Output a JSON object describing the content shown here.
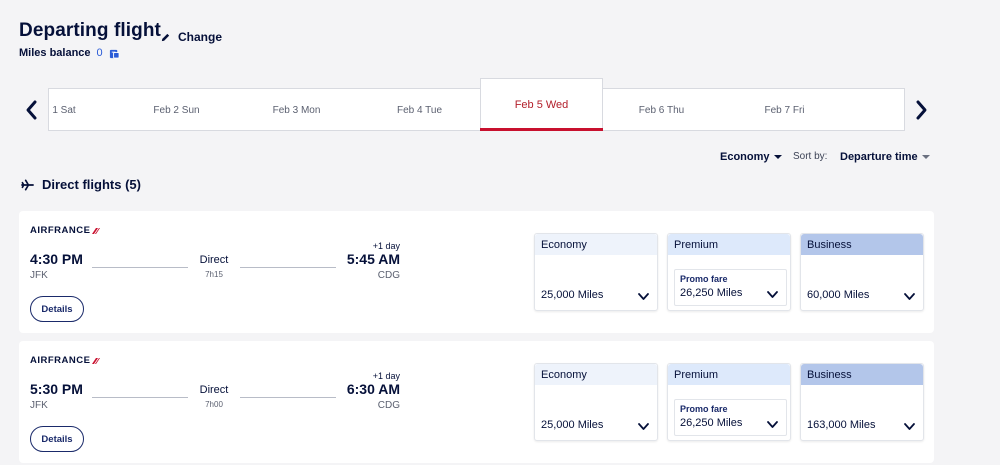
{
  "header": {
    "title": "Departing flight",
    "miles_label": "Miles balance",
    "miles_value": "0",
    "change_label": "Change"
  },
  "dates": [
    {
      "label": "1 Sat",
      "active": false
    },
    {
      "label": "Feb 2 Sun",
      "active": false
    },
    {
      "label": "Feb 3 Mon",
      "active": false
    },
    {
      "label": "Feb 4 Tue",
      "active": false
    },
    {
      "label": "Feb 5 Wed",
      "active": true
    },
    {
      "label": "Feb 6 Thu",
      "active": false
    },
    {
      "label": "Feb 7 Fri",
      "active": false
    }
  ],
  "filters": {
    "cabin": "Economy",
    "sort_label": "Sort by:",
    "sort_value": "Departure time"
  },
  "section_title": "Direct flights (5)",
  "flights": [
    {
      "airline": "AIRFRANCE",
      "dep_time": "4:30 PM",
      "dep_code": "JFK",
      "stops": "Direct",
      "duration": "7h15",
      "plus_day": "+1 day",
      "arr_time": "5:45 AM",
      "arr_code": "CDG",
      "details_label": "Details",
      "fares": {
        "economy": {
          "label": "Economy",
          "miles": "25,000 Miles"
        },
        "premium": {
          "label": "Premium",
          "promo": "Promo fare",
          "miles": "26,250 Miles"
        },
        "business": {
          "label": "Business",
          "miles": "60,000 Miles"
        }
      }
    },
    {
      "airline": "AIRFRANCE",
      "dep_time": "5:30 PM",
      "dep_code": "JFK",
      "stops": "Direct",
      "duration": "7h00",
      "plus_day": "+1 day",
      "arr_time": "6:30 AM",
      "arr_code": "CDG",
      "details_label": "Details",
      "fares": {
        "economy": {
          "label": "Economy",
          "miles": "25,000 Miles"
        },
        "premium": {
          "label": "Premium",
          "promo": "Promo fare",
          "miles": "26,250 Miles"
        },
        "business": {
          "label": "Business",
          "miles": "163,000 Miles"
        }
      }
    }
  ],
  "colors": {
    "navy": "#051039",
    "accent_red": "#c8102e",
    "economy_head": "#eef3fb",
    "premium_head": "#dde9fb",
    "business_head": "#b3c6ea",
    "link_blue": "#2a5bd7"
  },
  "icons": {
    "pencil": "pencil-icon",
    "wallet": "miles-wallet-icon",
    "plane": "plane-icon",
    "prev": "chevron-left-icon",
    "next": "chevron-right-icon"
  }
}
